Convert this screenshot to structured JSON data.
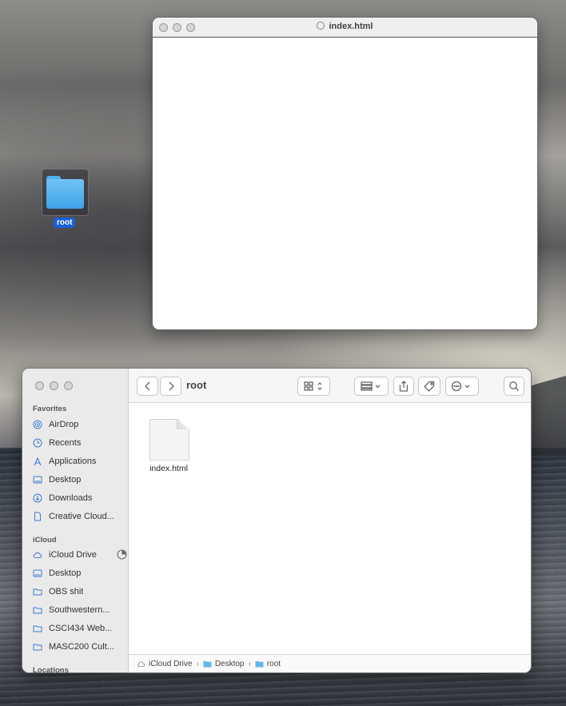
{
  "desktop": {
    "folder_label": "root"
  },
  "browser": {
    "title": "index.html"
  },
  "finder": {
    "sidebar": {
      "favorites_heading": "Favorites",
      "favorites": [
        {
          "label": "AirDrop",
          "icon": "airdrop-icon"
        },
        {
          "label": "Recents",
          "icon": "clock-icon"
        },
        {
          "label": "Applications",
          "icon": "applications-icon"
        },
        {
          "label": "Desktop",
          "icon": "desktop-icon"
        },
        {
          "label": "Downloads",
          "icon": "download-icon"
        },
        {
          "label": "Creative Cloud...",
          "icon": "document-icon"
        }
      ],
      "icloud_heading": "iCloud",
      "icloud": [
        {
          "label": "iCloud Drive",
          "icon": "cloud-icon"
        },
        {
          "label": "Desktop",
          "icon": "desktop-icon"
        },
        {
          "label": "OBS shit",
          "icon": "folder-icon"
        },
        {
          "label": "Southwestern...",
          "icon": "folder-icon"
        },
        {
          "label": "CSCI434 Web...",
          "icon": "folder-icon"
        },
        {
          "label": "MASC200 Cult...",
          "icon": "folder-icon"
        }
      ],
      "locations_heading": "Locations"
    },
    "toolbar": {
      "title": "root"
    },
    "files": [
      {
        "name": "index.html",
        "icon": "html-document-icon"
      }
    ],
    "path": [
      {
        "label": "iCloud Drive",
        "icon": "cloud-icon"
      },
      {
        "label": "Desktop",
        "icon": "folder-icon"
      },
      {
        "label": "root",
        "icon": "folder-icon"
      }
    ],
    "accent_color": "#3a7bd5"
  }
}
